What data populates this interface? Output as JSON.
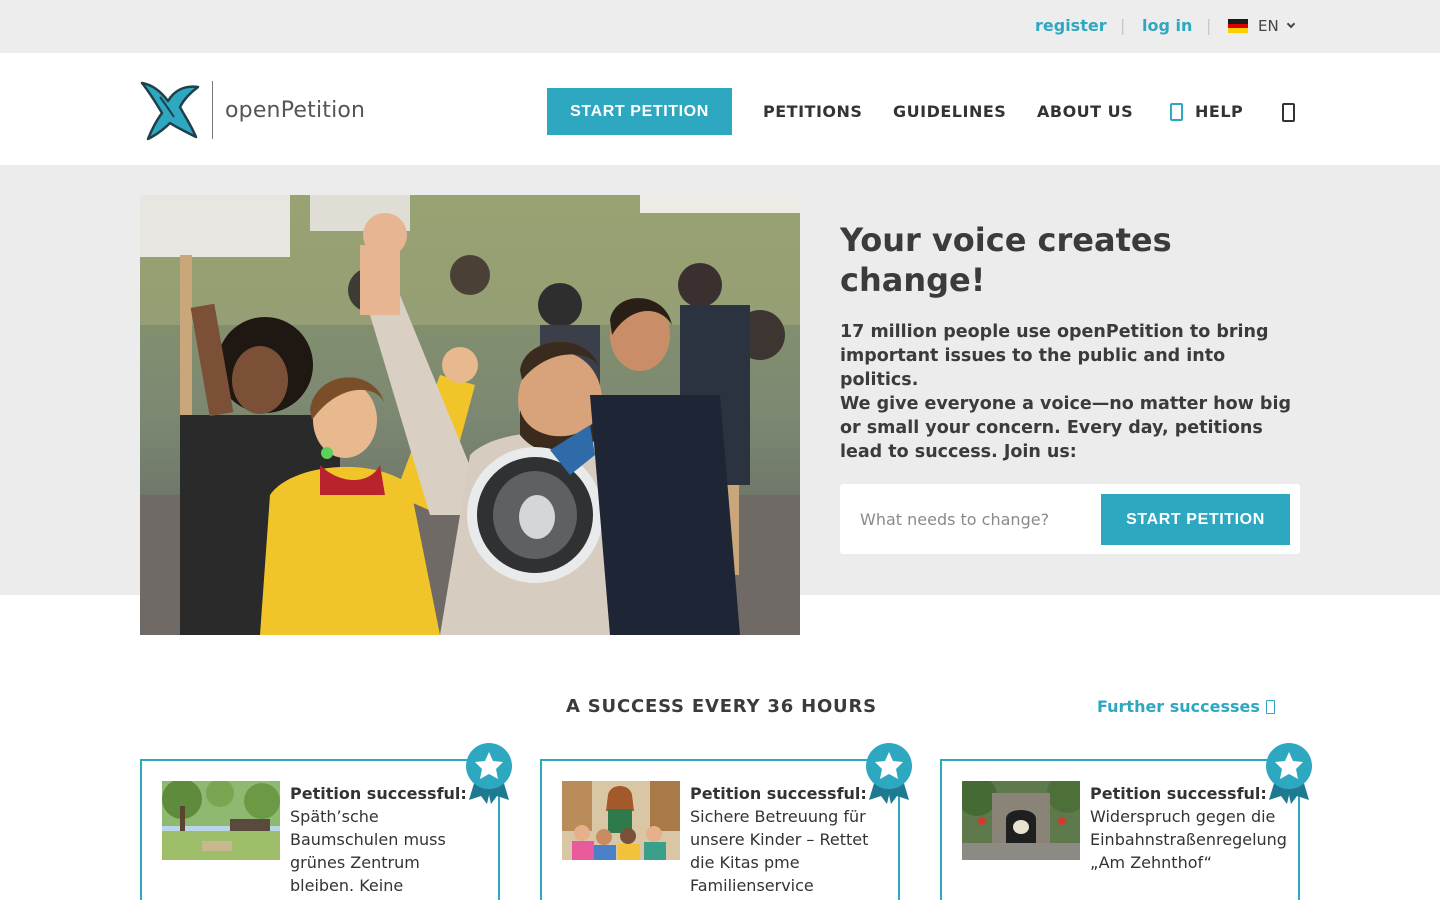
{
  "topbar": {
    "register": "register",
    "login": "log in",
    "separator": "|",
    "language": "EN"
  },
  "brand": {
    "name": "openPetition"
  },
  "nav": {
    "start_petition": "START PETITION",
    "petitions": "PETITIONS",
    "guidelines": "GUIDELINES",
    "about_us": "ABOUT US",
    "help": "HELP"
  },
  "hero": {
    "title": "Your voice creates change!",
    "body_1": "17 million people use openPetition to bring important issues to the public and into politics.",
    "body_2": "We give everyone a voice—no matter how big or small your concern. Every day, petitions lead to success. Join us:",
    "input_placeholder": "What needs to change?",
    "submit": "START PETITION"
  },
  "successes": {
    "heading": "A SUCCESS EVERY 36 HOURS",
    "further_link": "Further successes",
    "cards": [
      {
        "label": "Petition successful:",
        "text": "Späth’sche Baumschulen muss grünes Zentrum bleiben. Keine"
      },
      {
        "label": "Petition successful:",
        "text": "Sichere Betreuung für unsere Kinder – Rettet die Kitas pme Familienservice"
      },
      {
        "label": "Petition successful:",
        "text": "Widerspruch gegen die Einbahnstraßenregelung „Am Zehnthof“"
      }
    ]
  },
  "colors": {
    "accent": "#2ea8c0",
    "topbar_bg": "#ededed",
    "hero_bg": "#ececec",
    "text_dark": "#3b3b3b"
  },
  "icons": [
    "germany-flag-icon",
    "chevron-down-icon",
    "help-icon",
    "search-icon",
    "arrow-right-icon",
    "award-badge-icon",
    "bird-logo-icon"
  ]
}
